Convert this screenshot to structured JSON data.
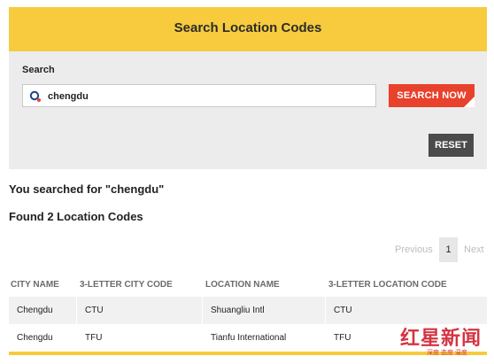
{
  "header": {
    "title": "Search Location Codes"
  },
  "search": {
    "label": "Search",
    "value": "chengdu",
    "button_label": "SEARCH NOW",
    "reset_label": "RESET"
  },
  "results": {
    "searched_text": "You searched for \"chengdu\"",
    "found_text": "Found 2 Location Codes"
  },
  "pagination": {
    "previous": "Previous",
    "current_page": "1",
    "next": "Next"
  },
  "table": {
    "headers": [
      "CITY NAME",
      "3-LETTER CITY CODE",
      "LOCATION NAME",
      "3-LETTER LOCATION CODE"
    ],
    "rows": [
      [
        "Chengdu",
        "CTU",
        "Shuangliu Intl",
        "CTU"
      ],
      [
        "Chengdu",
        "TFU",
        "Tianfu International",
        "TFU"
      ]
    ]
  },
  "watermark": {
    "text": "红星新闻",
    "subtext": "深度 态度 温度"
  },
  "colors": {
    "accent_yellow": "#f7cb3d",
    "search_button": "#e8412c",
    "reset_button": "#4b4b4b",
    "panel_bg": "#ececec",
    "watermark_red": "#cf1f2e"
  },
  "icons": {
    "search": "search-icon"
  }
}
